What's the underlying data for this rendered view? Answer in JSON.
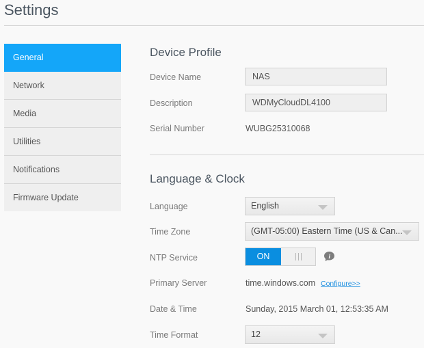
{
  "page": {
    "title": "Settings"
  },
  "sidebar": {
    "items": [
      {
        "label": "General",
        "active": true
      },
      {
        "label": "Network"
      },
      {
        "label": "Media"
      },
      {
        "label": "Utilities"
      },
      {
        "label": "Notifications"
      },
      {
        "label": "Firmware Update"
      }
    ]
  },
  "device_profile": {
    "title": "Device Profile",
    "device_name_label": "Device Name",
    "device_name_value": "NAS",
    "description_label": "Description",
    "description_value": "WDMyCloudDL4100",
    "serial_label": "Serial Number",
    "serial_value": "WUBG25310068"
  },
  "language_clock": {
    "title": "Language & Clock",
    "language_label": "Language",
    "language_value": "English",
    "timezone_label": "Time Zone",
    "timezone_value": "(GMT-05:00) Eastern Time (US & Can...",
    "ntp_label": "NTP Service",
    "ntp_state": "ON",
    "primary_server_label": "Primary Server",
    "primary_server_value": "time.windows.com",
    "configure_link": "Configure>>",
    "datetime_label": "Date & Time",
    "datetime_value": "Sunday, 2015 March 01, 12:53:35 AM",
    "time_format_label": "Time Format",
    "time_format_value": "12"
  },
  "colors": {
    "accent": "#14a6f9",
    "toggle_on": "#0a8ee0",
    "link": "#1d8fe0"
  }
}
